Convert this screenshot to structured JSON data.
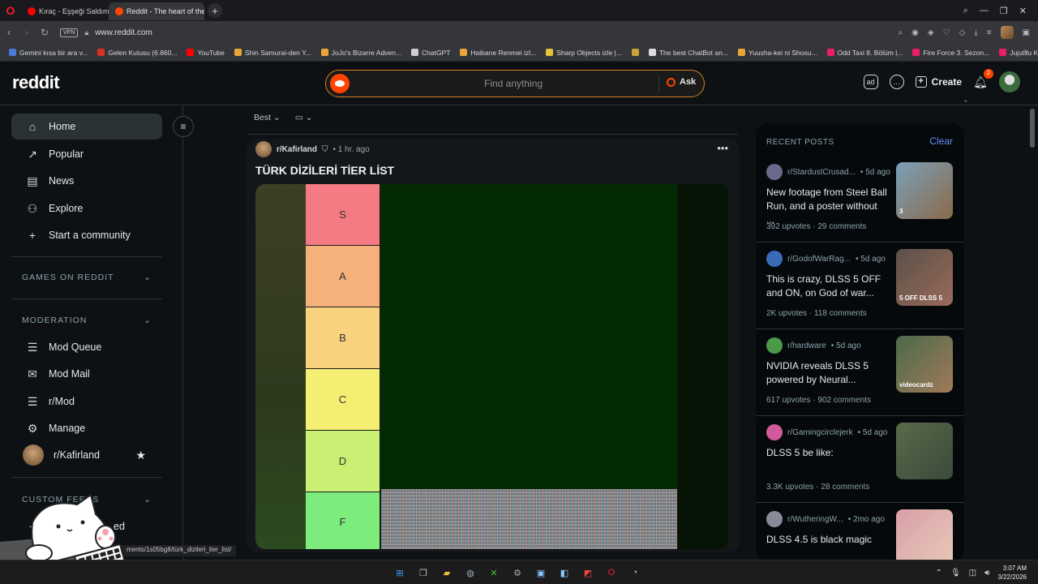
{
  "browser": {
    "tabs": [
      {
        "label": "Kıraç - Eşşeği Saldım (",
        "active": false,
        "color": "#ff0000"
      },
      {
        "label": "Reddit - The heart of the",
        "active": true,
        "color": "#ff4500"
      }
    ],
    "newtab": "+",
    "url": "www.reddit.com",
    "vpn": "VPN",
    "bookmarks": [
      {
        "label": "Gemini kısa bir ara v...",
        "color": "#4a7bd6"
      },
      {
        "label": "Gelen Kutusu (6.860...",
        "color": "#d93025"
      },
      {
        "label": "YouTube",
        "color": "#ff0000"
      },
      {
        "label": "Shin Samurai-den Y...",
        "color": "#e8a63a"
      },
      {
        "label": "JoJo's Bizarre Adven...",
        "color": "#e8a63a"
      },
      {
        "label": "ChatGPT",
        "color": "#cfcfcf"
      },
      {
        "label": "Haibane Renmei izl...",
        "color": "#e8a63a"
      },
      {
        "label": "Sharp Objects izle |...",
        "color": "#e8c23a"
      },
      {
        "label": "",
        "color": "#c9a23a"
      },
      {
        "label": "The best ChatBot an...",
        "color": "#dddddd"
      },
      {
        "label": "Yuusha-kei ni Shosu...",
        "color": "#e8a63a"
      },
      {
        "label": "Odd Taxi 8. Bölüm |...",
        "color": "#e91e63"
      },
      {
        "label": "Fire Force 3. Sezon...",
        "color": "#e91e63"
      },
      {
        "label": "Jujutsu Kaisen 3. Se...",
        "color": "#e91e63"
      }
    ],
    "bookmarks_more": "»"
  },
  "header": {
    "logo": "reddit",
    "search_placeholder": "Find anything",
    "ask_label": "Ask",
    "create_label": "Create",
    "notification_count": "2"
  },
  "sidebar": {
    "items": [
      {
        "label": "Home",
        "icon": "⌂"
      },
      {
        "label": "Popular",
        "icon": "↗"
      },
      {
        "label": "News",
        "icon": "▤"
      },
      {
        "label": "Explore",
        "icon": "⚇"
      },
      {
        "label": "Start a community",
        "icon": "+"
      }
    ],
    "games_heading": "GAMES ON REDDIT",
    "moderation_heading": "MODERATION",
    "mod_items": [
      {
        "label": "Mod Queue",
        "icon": "☰"
      },
      {
        "label": "Mod Mail",
        "icon": "✉"
      },
      {
        "label": "r/Mod",
        "icon": "☰"
      },
      {
        "label": "Manage",
        "icon": "⚙"
      }
    ],
    "community": "r/Kafirland",
    "custom_feeds_heading": "CUSTOM FEEDS",
    "create_feed_label": "ed"
  },
  "feed": {
    "sort_label": "Best",
    "post": {
      "subreddit": "r/Kafirland",
      "time": "• 1 hr. ago",
      "title": "TÜRK DİZİLERİ TİER LİST",
      "tiers": [
        {
          "label": "S",
          "color": "#f47a84"
        },
        {
          "label": "A",
          "color": "#f6b07c"
        },
        {
          "label": "B",
          "color": "#f8d27e"
        },
        {
          "label": "C",
          "color": "#f4ef72"
        },
        {
          "label": "D",
          "color": "#c9ef73"
        },
        {
          "label": "F",
          "color": "#7cec7c"
        }
      ]
    }
  },
  "recent_posts": {
    "heading": "RECENT POSTS",
    "clear_label": "Clear",
    "posts": [
      {
        "sub": "r/StardustCrusad...",
        "age": "• 5d ago",
        "title": "New footage from Steel Ball Run, and a poster without ...",
        "stats": "392 upvotes · 29 comments",
        "thumb_badge": "3",
        "thumb_colors": [
          "#7aa0b8",
          "#8a6a4a"
        ],
        "avatar_color": "#6a6a8a"
      },
      {
        "sub": "r/GodofWarRag...",
        "age": "• 5d ago",
        "title": "This is crazy, DLSS 5 OFF and ON, on God of war...",
        "stats": "2K upvotes · 118 comments",
        "thumb_badge": "5 OFF   DLSS 5",
        "thumb_colors": [
          "#5a5048",
          "#9a6a5a"
        ],
        "avatar_color": "#3a6ab8"
      },
      {
        "sub": "r/hardware",
        "age": "• 5d ago",
        "title": "NVIDIA reveals DLSS 5 powered by Neural...",
        "stats": "617 upvotes · 902 comments",
        "thumb_badge": "videocardz",
        "thumb_colors": [
          "#4a6a4a",
          "#a07a5a"
        ],
        "avatar_color": "#4a9a4a"
      },
      {
        "sub": "r/Gamingcirclejerk",
        "age": "• 5d ago",
        "title": "DLSS 5 be like:",
        "stats": "3.3K upvotes · 28 comments",
        "thumb_badge": "",
        "thumb_colors": [
          "#5a6a4a",
          "#3a4a3a"
        ],
        "avatar_color": "#d05a9a"
      },
      {
        "sub": "r/WutheringW...",
        "age": "• 2mo ago",
        "title": "DLSS 4.5 is black magic",
        "stats": "",
        "thumb_badge": "",
        "thumb_colors": [
          "#d8a0a8",
          "#e8c8b8"
        ],
        "avatar_color": "#8a8a9a"
      }
    ]
  },
  "status_url": "ments/1s05bg8/türk_dizileri_tier_list/",
  "taskbar": {
    "time": "3:07 AM",
    "date": "3/22/2026"
  }
}
